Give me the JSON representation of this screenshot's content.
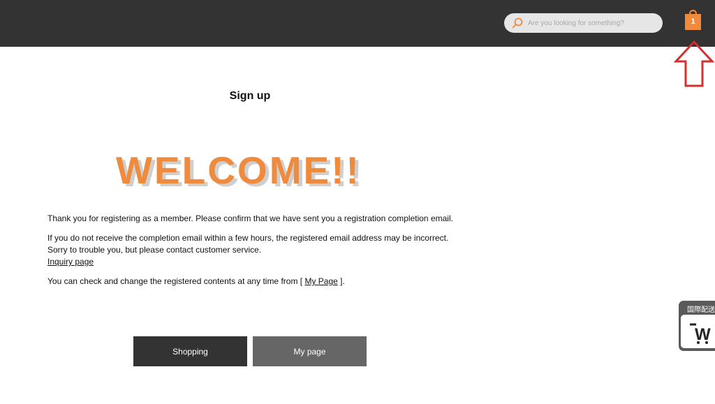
{
  "header": {
    "search": {
      "placeholder": "Are you looking for something?"
    },
    "cart": {
      "count": "1"
    },
    "colors": {
      "bar": "#333333",
      "accent": "#f08a3c"
    },
    "annotation": {
      "icon": "up-arrow-icon",
      "color": "#d32f2f"
    }
  },
  "page": {
    "title": "Sign up",
    "welcome": "WELCOME!!",
    "message": {
      "line1": "Thank you for registering as a member. Please confirm that we have sent you a registration completion email.",
      "line2": "If you do not receive the completion email within a few hours, the registered email address may be incorrect.",
      "line3": "Sorry to trouble you, but please contact customer service.",
      "inquiry_link": "Inquiry page",
      "line4_prefix": "You can check and change the registered contents at any time from [",
      "mypage_link": "My Page",
      "line4_suffix": "]."
    },
    "buttons": {
      "shopping": "Shopping",
      "mypage": "My page"
    }
  },
  "widget": {
    "label": "国際配送",
    "logo_text": "W"
  }
}
